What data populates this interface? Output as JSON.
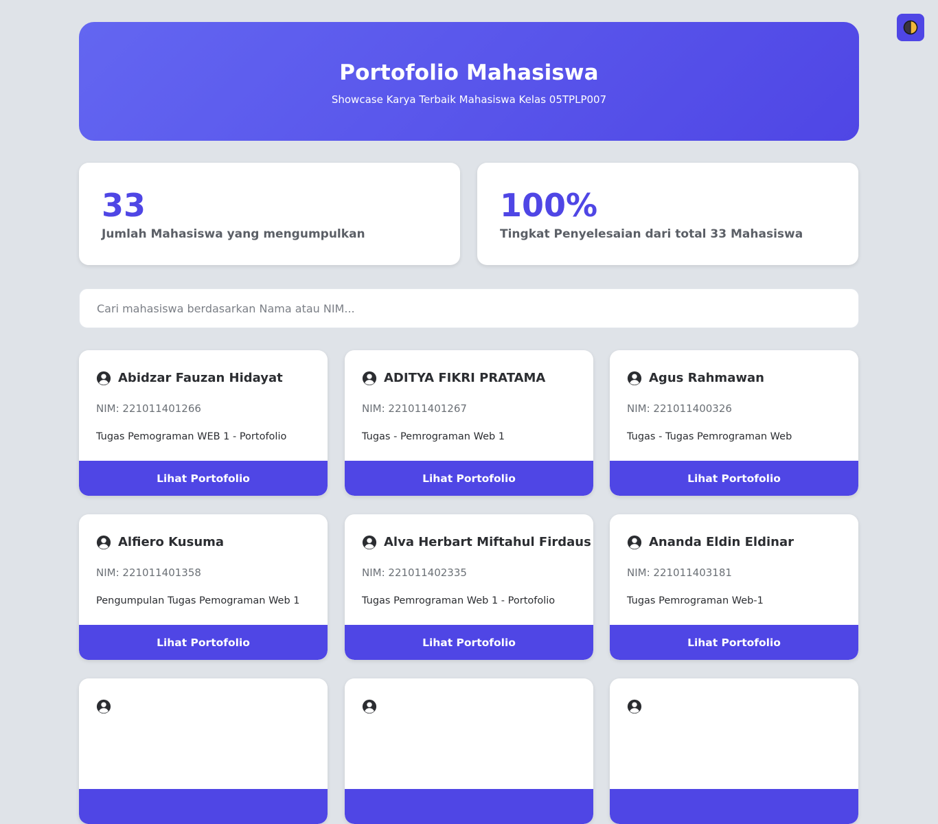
{
  "theme_toggle": {
    "icon": "half-moon-icon",
    "background": "#4f46e5"
  },
  "header": {
    "title": "Portofolio Mahasiswa",
    "subtitle": "Showcase Karya Terbaik Mahasiswa Kelas 05TPLP007",
    "gradient_start": "#6366f1",
    "gradient_end": "#4f46e5"
  },
  "stats": {
    "submitted": {
      "value": "33",
      "label": "Jumlah Mahasiswa yang mengumpulkan"
    },
    "completion": {
      "value": "100%",
      "label": "Tingkat Penyelesaian dari total 33 Mahasiswa"
    }
  },
  "search": {
    "placeholder": "Cari mahasiswa berdasarkan Nama atau NIM...",
    "value": ""
  },
  "accent_color": "#4f46e5",
  "students": [
    {
      "name": "Abidzar Fauzan Hidayat",
      "nim": "NIM: 221011401266",
      "task": "Tugas Pemograman WEB 1 - Portofolio",
      "button_label": "Lihat Portofolio",
      "icon": "user-circle-icon"
    },
    {
      "name": "ADITYA FIKRI PRATAMA",
      "nim": "NIM: 221011401267",
      "task": "Tugas - Pemrograman Web 1",
      "button_label": "Lihat Portofolio",
      "icon": "user-circle-icon"
    },
    {
      "name": "Agus Rahmawan",
      "nim": "NIM: 221011400326",
      "task": "Tugas - Tugas Pemrograman Web",
      "button_label": "Lihat Portofolio",
      "icon": "user-circle-icon"
    },
    {
      "name": "Alfiero Kusuma",
      "nim": "NIM: 221011401358",
      "task": "Pengumpulan Tugas Pemograman Web 1",
      "button_label": "Lihat Portofolio",
      "icon": "user-circle-icon"
    },
    {
      "name": "Alva Herbart Miftahul Firdaus",
      "nim": "NIM: 221011402335",
      "task": "Tugas Pemrograman Web 1 - Portofolio",
      "button_label": "Lihat Portofolio",
      "icon": "user-circle-icon"
    },
    {
      "name": "Ananda Eldin Eldinar",
      "nim": "NIM: 221011403181",
      "task": "Tugas Pemrograman Web-1",
      "button_label": "Lihat Portofolio",
      "icon": "user-circle-icon"
    },
    {
      "name": "",
      "nim": "",
      "task": "",
      "button_label": "",
      "icon": "user-circle-icon"
    },
    {
      "name": "",
      "nim": "",
      "task": "",
      "button_label": "",
      "icon": "user-circle-icon"
    },
    {
      "name": "",
      "nim": "",
      "task": "",
      "button_label": "",
      "icon": "user-circle-icon"
    }
  ]
}
